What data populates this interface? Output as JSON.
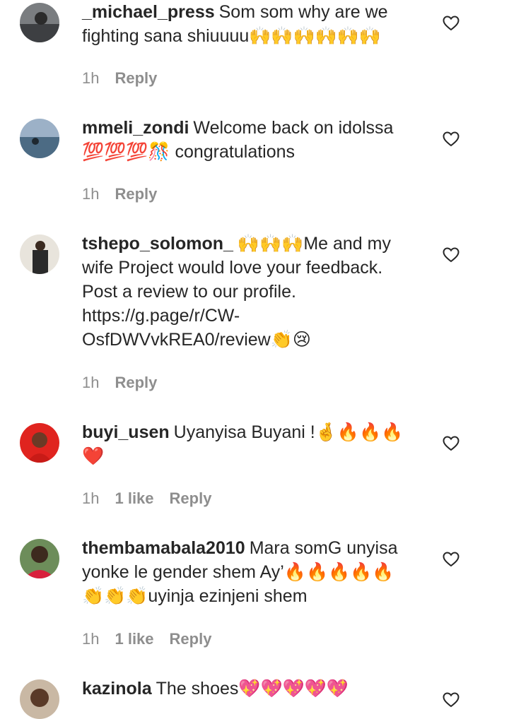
{
  "comments": [
    {
      "username": "_michael_press",
      "text": "Som som why are we fighting sana shiuuuu",
      "emoji": "🙌🙌🙌🙌🙌🙌",
      "time": "1h",
      "likes": "",
      "reply_label": "Reply"
    },
    {
      "username": "mmeli_zondi",
      "text": "Welcome back on idolssa",
      "emoji": "💯💯💯🎊",
      "text2": "congratulations",
      "time": "1h",
      "likes": "",
      "reply_label": "Reply"
    },
    {
      "username": "tshepo_solomon_",
      "emoji": "🙌🙌🙌",
      "text": "Me and my wife Project would love your feedback. Post a review to our profile. https://g.page/r/CW-OsfDWVvkREA0/review",
      "emoji2": "👏😢",
      "time": "1h",
      "likes": "",
      "reply_label": "Reply"
    },
    {
      "username": "buyi_usen",
      "text": "Uyanyisa Buyani !",
      "emoji": "🤞🔥🔥🔥 ❤️",
      "time": "1h",
      "likes": "1 like",
      "reply_label": "Reply"
    },
    {
      "username": "thembamabala2010",
      "text": "Mara somG unyisa yonke le gender shem Ay’",
      "emoji": "🔥🔥🔥🔥🔥 👏👏👏",
      "text2": "uyinja ezinjeni shem",
      "time": "1h",
      "likes": "1 like",
      "reply_label": "Reply"
    },
    {
      "username": "kazinola",
      "text": "The shoes",
      "emoji": "💖💖💖💖💖",
      "time": "",
      "likes": "",
      "reply_label": ""
    }
  ],
  "icons": {
    "like": "heart-outline-icon"
  },
  "colors": {
    "username": "#262626",
    "meta": "#8e8e8e"
  }
}
